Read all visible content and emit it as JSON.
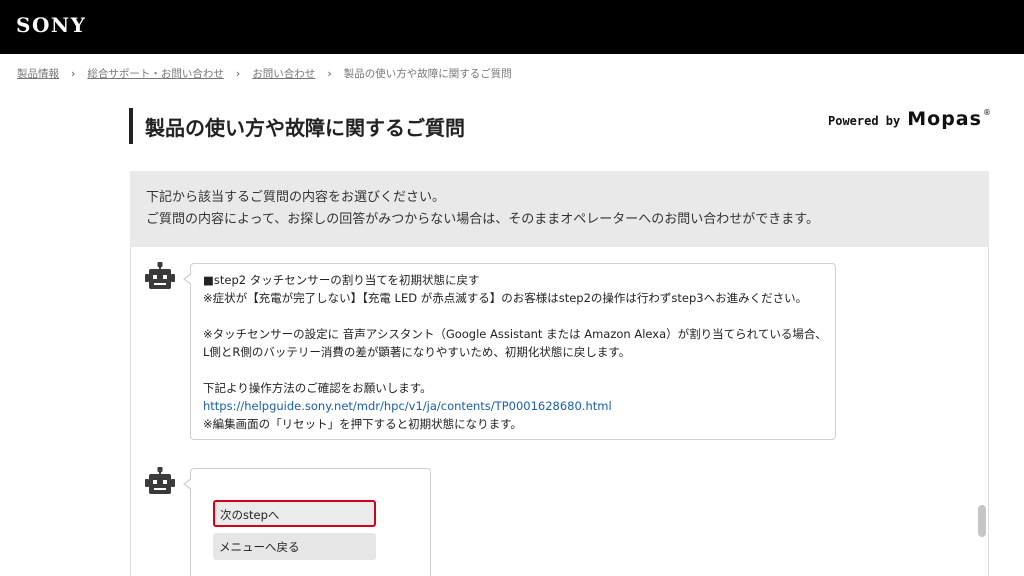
{
  "header": {
    "logo": "SONY"
  },
  "breadcrumb": {
    "items": [
      "製品情報",
      "総合サポート・お問い合わせ",
      "お問い合わせ"
    ],
    "current": "製品の使い方や故障に関するご質問",
    "separator": "›"
  },
  "page": {
    "title": "製品の使い方や故障に関するご質問",
    "powered_by": {
      "prefix": "Powered by",
      "brand": "Mopas",
      "mark": "®"
    }
  },
  "notice": {
    "line1": "下記から該当するご質問の内容をお選びください。",
    "line2": "ご質問の内容によって、お探しの回答がみつからない場合は、そのままオペレーターへのお問い合わせができます。"
  },
  "chat": {
    "message1": {
      "line1": "■step2 タッチセンサーの割り当てを初期状態に戻す",
      "line2": "※症状が【充電が完了しない】【充電 LED が赤点滅する】のお客様はstep2の操作は行わずstep3へお進みください。",
      "line3": "※タッチセンサーの設定に 音声アシスタント（Google Assistant または Amazon Alexa）が割り当てられている場合、",
      "line4": "L側とR側のバッテリー消費の差が顕著になりやすいため、初期化状態に戻します。",
      "line5": "下記より操作方法のご確認をお願いします。",
      "link": "https://helpguide.sony.net/mdr/hpc/v1/ja/contents/TP0001628680.html",
      "line6": "※編集画面の「リセット」を押下すると初期状態になります。"
    },
    "message2": {
      "next_label": "次のstepへ",
      "menu_label": "メニューへ戻る"
    }
  },
  "colors": {
    "highlight": "#d0021b",
    "link": "#1a5fa8",
    "header_bg": "#000000"
  }
}
